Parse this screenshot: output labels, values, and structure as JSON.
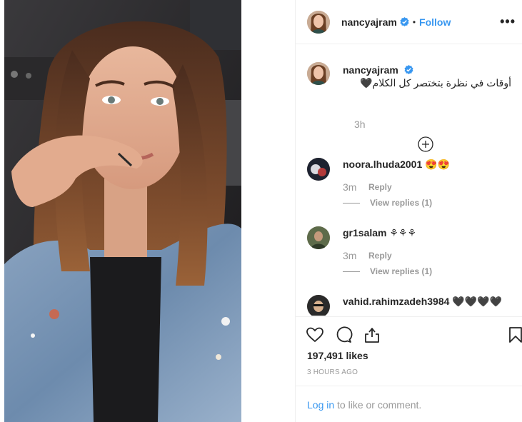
{
  "post": {
    "username": "nancyajram",
    "follow_label": "Follow",
    "more_label": "•••",
    "separator": "•"
  },
  "caption": {
    "username": "nancyajram",
    "text": "أوقات في نظرة بتختصر كل الكلام🖤",
    "time": "3h"
  },
  "comments": [
    {
      "username": "noora.lhuda2001",
      "text": "😍😍",
      "time": "3m",
      "reply_label": "Reply",
      "view_replies": "View replies (1)"
    },
    {
      "username": "gr1salam",
      "text": "⚘⚘⚘",
      "time": "3m",
      "reply_label": "Reply",
      "view_replies": "View replies (1)"
    },
    {
      "username": "vahid.rahimzadeh3984",
      "text": "🖤🖤🖤🖤"
    }
  ],
  "stats": {
    "likes": "197,491 likes",
    "posted_ago": "3 HOURS AGO"
  },
  "login": {
    "link": "Log in",
    "rest": " to like or comment."
  },
  "icons": {
    "verified": "verified-badge-icon",
    "heart": "heart-icon",
    "comment": "comment-bubble-icon",
    "share": "share-icon",
    "save": "bookmark-icon",
    "load_more": "plus-circle-icon"
  },
  "colors": {
    "link_blue": "#3897f0",
    "verified_blue": "#3897f0",
    "muted_text": "#999999",
    "divider": "#efefef"
  }
}
